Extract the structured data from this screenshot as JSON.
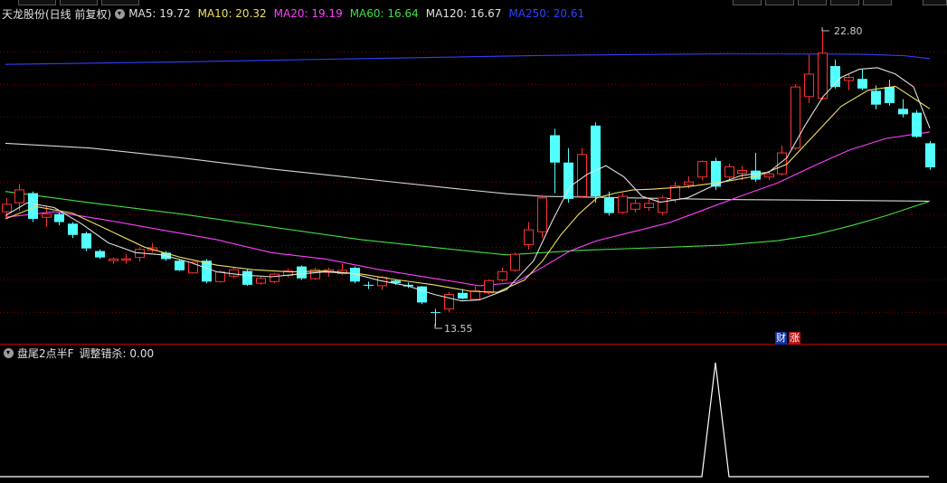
{
  "header": {
    "stock_label": "天龙股份(日线 前复权)",
    "ma": [
      {
        "label": "MA5: 19.72",
        "color": "#e0e0e0"
      },
      {
        "label": "MA10: 20.32",
        "color": "#f0e060"
      },
      {
        "label": "MA20: 19.19",
        "color": "#ff40ff"
      },
      {
        "label": "MA60: 16.64",
        "color": "#40e040"
      },
      {
        "label": "MA120: 16.67",
        "color": "#e0e0e0"
      },
      {
        "label": "MA250: 20.61",
        "color": "#3040ff"
      }
    ]
  },
  "indicator": {
    "label": "盘尾2点半F",
    "value_label": "调整错杀: 0.00"
  },
  "annotations": {
    "high": "22.80",
    "low": "13.55"
  },
  "badges": {
    "cai": "财",
    "zhang": "涨"
  },
  "colors": {
    "up": "#ff3232",
    "down": "#54ffff",
    "grid": "#7a0000",
    "ma250": "#3040ff",
    "ma120": "#d8d8d8",
    "ma60": "#40e040",
    "ma20": "#ff40ff",
    "ma10": "#f0e060",
    "ma5": "#e0e0e0"
  }
}
